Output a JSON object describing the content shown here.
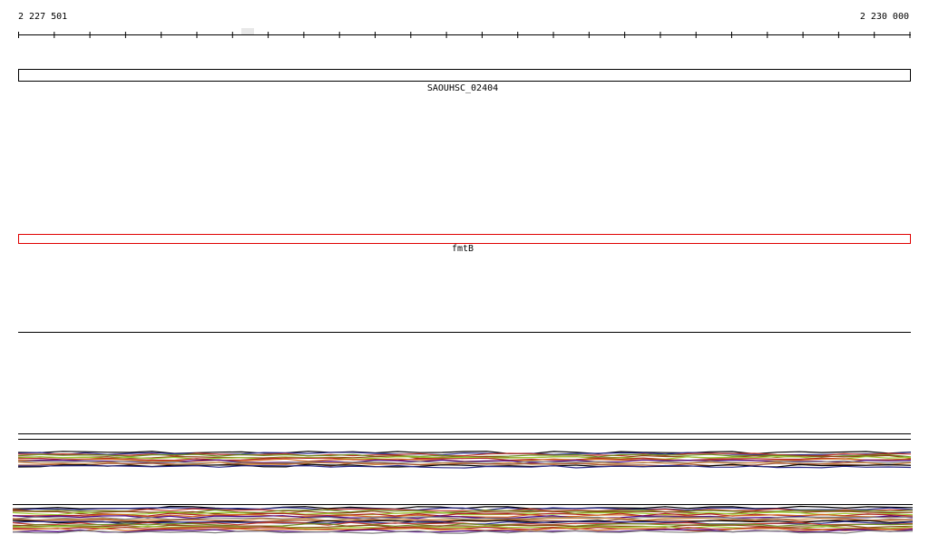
{
  "ruler": {
    "start_label": "2 227 501",
    "end_label": "2 230 000"
  },
  "tracks": {
    "gene1": {
      "name": "SAOUHSC_02404",
      "stroke": "#000000"
    },
    "gene2": {
      "name": "fmtB",
      "stroke": "#e00000"
    }
  },
  "coverage_colors": [
    "#000000",
    "#2b2b8a",
    "#c0392b",
    "#6b8e23",
    "#8b4513",
    "#9acd32",
    "#b22222",
    "#d2691e",
    "#4b0082",
    "#808080",
    "#cd853f",
    "#a0522d"
  ]
}
